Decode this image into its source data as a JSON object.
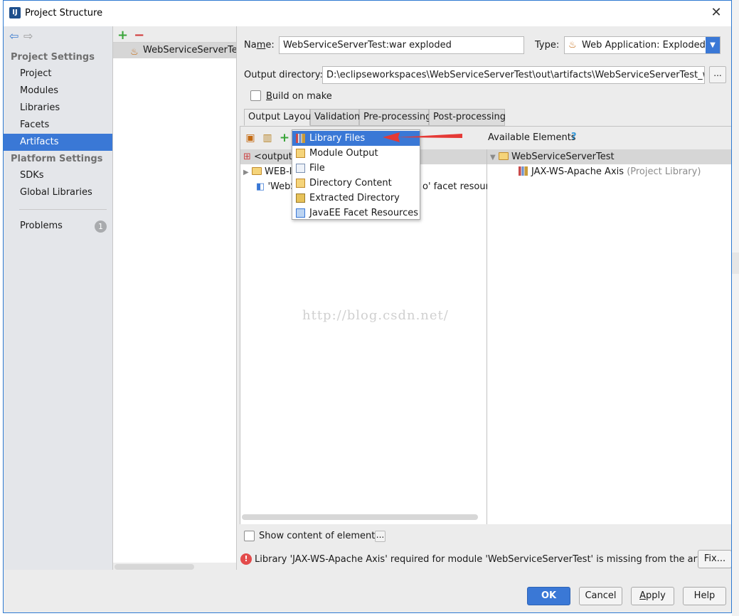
{
  "window": {
    "title": "Project Structure",
    "app_icon": "IJ"
  },
  "nav": {
    "back_icon": "arrow-left-icon",
    "forward_icon": "arrow-right-icon"
  },
  "sidebar": {
    "project_settings_header": "Project Settings",
    "project_items": [
      "Project",
      "Modules",
      "Libraries",
      "Facets",
      "Artifacts"
    ],
    "selected": "Artifacts",
    "platform_settings_header": "Platform Settings",
    "platform_items": [
      "SDKs",
      "Global Libraries"
    ],
    "problems_label": "Problems",
    "problems_count": "1"
  },
  "artifacts": {
    "add_icon": "+",
    "remove_icon": "−",
    "items": [
      "WebServiceServerTest:"
    ]
  },
  "form": {
    "name_label": "Name:",
    "name_value": "WebServiceServerTest:war exploded",
    "type_label": "Type:",
    "type_value": "Web Application: Exploded",
    "output_dir_label": "Output directory:",
    "output_dir_value": "D:\\eclipseworkspaces\\WebServiceServerTest\\out\\artifacts\\WebServiceServerTest_war_expl",
    "browse_label": "...",
    "build_on_make_label": "Build on make",
    "build_on_make_checked": false
  },
  "tabs": [
    "Output Layout",
    "Validation",
    "Pre-processing",
    "Post-processing"
  ],
  "active_tab": "Output Layout",
  "layout_tree": {
    "root": "<output r",
    "row1": "WEB-I",
    "row2_start": "'WebS",
    "row2_end": "o' facet resource"
  },
  "popup_menu": {
    "items": [
      "Library Files",
      "Module Output",
      "File",
      "Directory Content",
      "Extracted Directory",
      "JavaEE Facet Resources"
    ],
    "selected": "Library Files"
  },
  "available_elements": {
    "header": "Available Elements",
    "help": "?",
    "module": "WebServiceServerTest",
    "library": "JAX-WS-Apache Axis",
    "library_note": "(Project Library)"
  },
  "watermark": "http://blog.csdn.net/",
  "show_content_label": "Show content of elements",
  "show_content_btn": "...",
  "error_message": "Library 'JAX-WS-Apache Axis' required for module 'WebServiceServerTest' is missing from the artifact",
  "fix_label": "Fix...",
  "buttons": {
    "ok": "OK",
    "cancel": "Cancel",
    "apply": "Apply",
    "help": "Help"
  },
  "colors": {
    "accent": "#3a78d6",
    "error": "#e34b4b",
    "arrow": "#e53935"
  }
}
